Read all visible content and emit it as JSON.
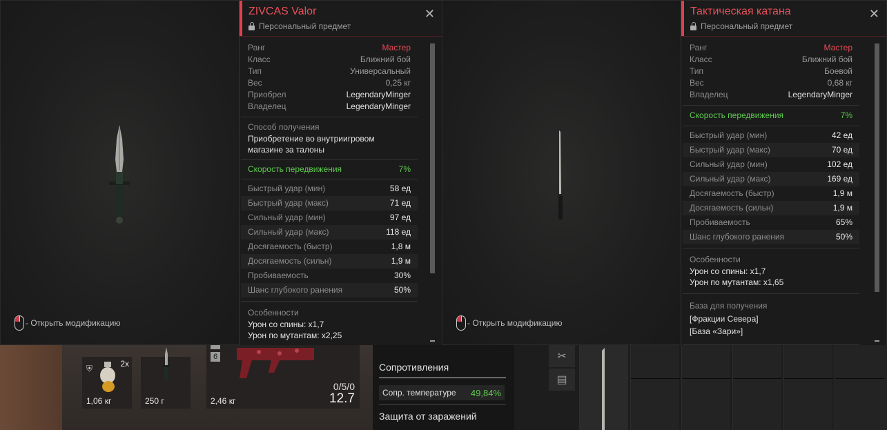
{
  "left": {
    "mod_hint": "- Открыть модификацию",
    "title": "ZIVCAS Valor",
    "subtitle": "Персональный предмет",
    "info": [
      {
        "label": "Ранг",
        "value": "Мастер"
      },
      {
        "label": "Класс",
        "value": "Ближний бой"
      },
      {
        "label": "Тип",
        "value": "Универсальный"
      },
      {
        "label": "Вес",
        "value": "0,25 кг"
      },
      {
        "label": "Приобрел",
        "value": "LegendaryMinger"
      },
      {
        "label": "Владелец",
        "value": "LegendaryMinger"
      }
    ],
    "acquire_heading": "Способ получения",
    "acquire_text": "Приобретение во внутриигровом магазине за талоны",
    "speed": {
      "label": "Скорость передвижения",
      "value": "7%"
    },
    "stats": [
      {
        "label": "Быстрый удар (мин)",
        "value": "58 ед"
      },
      {
        "label": "Быстрый удар (макс)",
        "value": "71 ед"
      },
      {
        "label": "Сильный удар (мин)",
        "value": "97 ед"
      },
      {
        "label": "Сильный удар (макс)",
        "value": "118 ед"
      },
      {
        "label": "Досягаемость (быстр)",
        "value": "1,8 м"
      },
      {
        "label": "Досягаемость (сильн)",
        "value": "1,9 м"
      },
      {
        "label": "Пробиваемость",
        "value": "30%"
      },
      {
        "label": "Шанс глубокого ранения",
        "value": "50%"
      }
    ],
    "features_heading": "Особенности",
    "features": [
      "Урон со спины: x1,7",
      "Урон по мутантам: x2,25"
    ]
  },
  "right": {
    "mod_hint": "- Открыть модификацию",
    "title": "Тактическая катана",
    "subtitle": "Персональный предмет",
    "info": [
      {
        "label": "Ранг",
        "value": "Мастер"
      },
      {
        "label": "Класс",
        "value": "Ближний бой"
      },
      {
        "label": "Тип",
        "value": "Боевой"
      },
      {
        "label": "Вес",
        "value": "0,68 кг"
      },
      {
        "label": "Владелец",
        "value": "LegendaryMinger"
      }
    ],
    "speed": {
      "label": "Скорость передвижения",
      "value": "7%"
    },
    "stats": [
      {
        "label": "Быстрый удар (мин)",
        "value": "42 ед"
      },
      {
        "label": "Быстрый удар (макс)",
        "value": "70 ед"
      },
      {
        "label": "Сильный удар (мин)",
        "value": "102 ед"
      },
      {
        "label": "Сильный удар (макс)",
        "value": "169 ед"
      },
      {
        "label": "Досягаемость (быстр)",
        "value": "1,9 м"
      },
      {
        "label": "Досягаемость (сильн)",
        "value": "1,9 м"
      },
      {
        "label": "Пробиваемость",
        "value": "65%"
      },
      {
        "label": "Шанс глубокого ранения",
        "value": "50%"
      }
    ],
    "features_heading": "Особенности",
    "features": [
      "Урон со спины: x1,7",
      "Урон по мутантам: x1,65"
    ],
    "base_heading": "База для получения",
    "bases": [
      "[Фракции Севера]",
      "[База «Зари»]"
    ]
  },
  "inventory": {
    "grenade_count": "2x",
    "grenade_weight": "1,06 кг",
    "knife_weight": "250 г",
    "gun_slot_badge": "6",
    "gun_weight": "2,46 кг",
    "ammo": "0/5/0",
    "gun_value": "12.7"
  },
  "resist": {
    "heading": "Сопротивления",
    "temp_label": "Сопр. температуре",
    "temp_value": "49,84%",
    "infection_heading": "Защита от заражений"
  },
  "colors": {
    "accent": "#e0404d",
    "green": "#5ec94f"
  }
}
